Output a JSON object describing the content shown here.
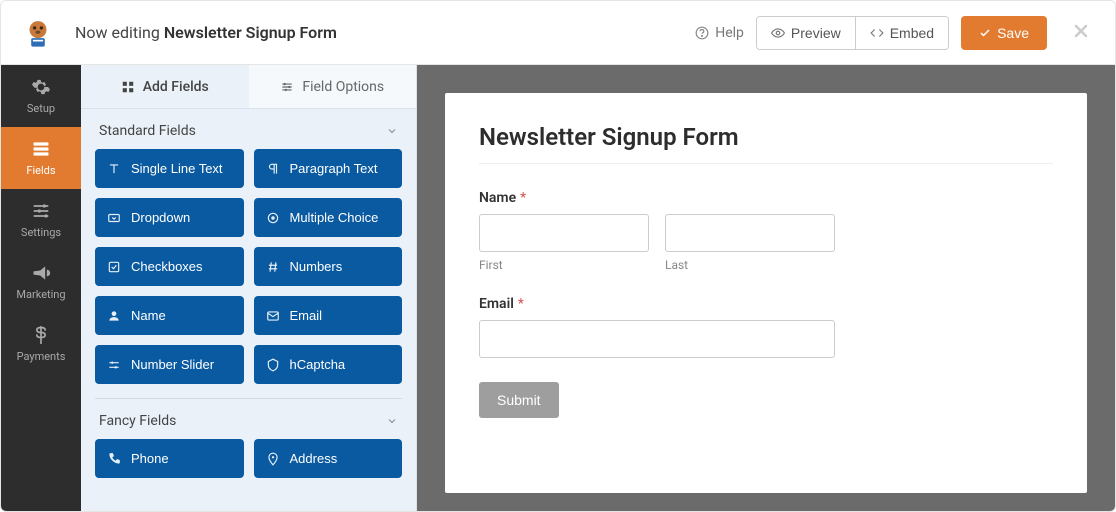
{
  "topbar": {
    "prefix": "Now editing",
    "form_name": "Newsletter Signup Form",
    "help": "Help",
    "preview": "Preview",
    "embed": "Embed",
    "save": "Save"
  },
  "sidenav": {
    "items": [
      {
        "id": "setup",
        "label": "Setup",
        "icon": "gear"
      },
      {
        "id": "fields",
        "label": "Fields",
        "icon": "form"
      },
      {
        "id": "settings",
        "label": "Settings",
        "icon": "sliders"
      },
      {
        "id": "marketing",
        "label": "Marketing",
        "icon": "bullhorn"
      },
      {
        "id": "payments",
        "label": "Payments",
        "icon": "dollar"
      }
    ],
    "active": "fields"
  },
  "panel": {
    "tabs": {
      "add": "Add Fields",
      "options": "Field Options",
      "active": "add"
    },
    "sections": [
      {
        "title": "Standard Fields",
        "fields": [
          {
            "label": "Single Line Text",
            "icon": "text"
          },
          {
            "label": "Paragraph Text",
            "icon": "paragraph"
          },
          {
            "label": "Dropdown",
            "icon": "dropdown"
          },
          {
            "label": "Multiple Choice",
            "icon": "radio"
          },
          {
            "label": "Checkboxes",
            "icon": "check"
          },
          {
            "label": "Numbers",
            "icon": "hash"
          },
          {
            "label": "Name",
            "icon": "user"
          },
          {
            "label": "Email",
            "icon": "mail"
          },
          {
            "label": "Number Slider",
            "icon": "slider"
          },
          {
            "label": "hCaptcha",
            "icon": "shield"
          }
        ]
      },
      {
        "title": "Fancy Fields",
        "fields": [
          {
            "label": "Phone",
            "icon": "phone"
          },
          {
            "label": "Address",
            "icon": "pin"
          }
        ]
      }
    ]
  },
  "form": {
    "title": "Newsletter Signup Form",
    "name_label": "Name",
    "first_label": "First",
    "last_label": "Last",
    "email_label": "Email",
    "submit": "Submit",
    "required_mark": "*"
  }
}
